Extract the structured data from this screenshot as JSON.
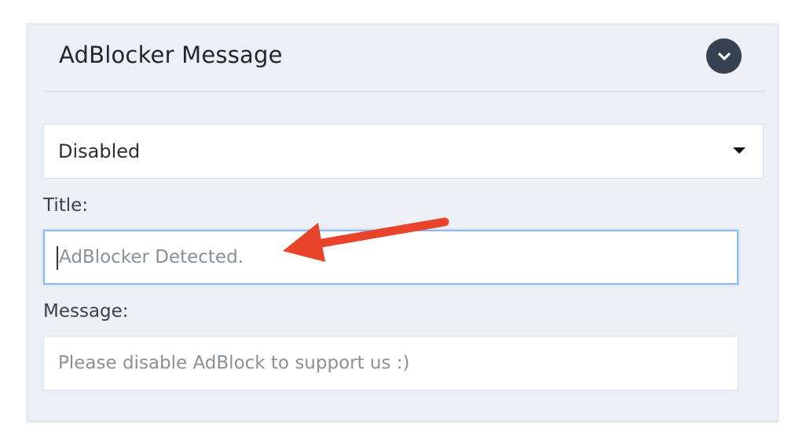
{
  "panel": {
    "title": "AdBlocker Message",
    "collapse_icon": "chevron-down-icon"
  },
  "select": {
    "value": "Disabled",
    "caret_icon": "caret-down-icon"
  },
  "title_field": {
    "label": "Title:",
    "value": "",
    "placeholder": "AdBlocker Detected."
  },
  "message_field": {
    "label": "Message:",
    "value": "",
    "placeholder": "Please disable AdBlock to support us :)"
  },
  "annotation": {
    "arrow_color": "#e8442b",
    "icon": "annotation-arrow-icon"
  },
  "colors": {
    "panel_bg": "#eceff4",
    "button_bg": "#364152",
    "focus_border": "#8bb8f2"
  }
}
